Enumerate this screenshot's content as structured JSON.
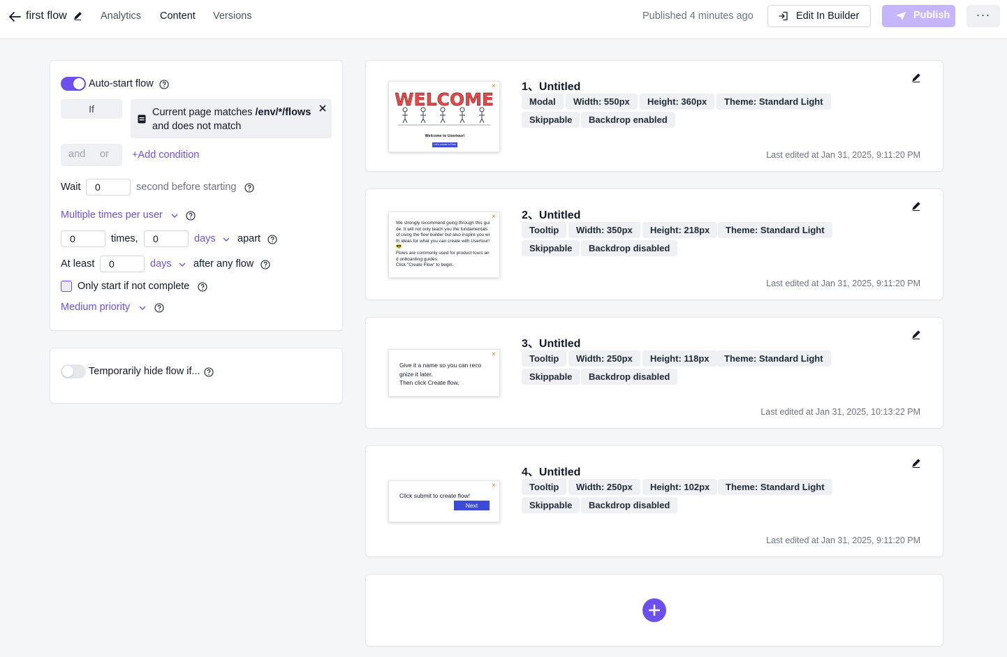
{
  "header": {
    "title": "first flow",
    "tabs": [
      {
        "label": "Analytics"
      },
      {
        "label": "Content"
      },
      {
        "label": "Versions"
      }
    ],
    "published_status": "Published 4 minutes ago",
    "edit_in_builder_label": "Edit In Builder",
    "publish_label": "Publish",
    "more_label": "···"
  },
  "colors": {
    "accent": "#6d4ff0",
    "publish_disabled": "#c4b5fd"
  },
  "autostart": {
    "toggle_on": true,
    "label": "Auto-start flow",
    "if_label": "If",
    "condition_prefix": "Current page matches ",
    "condition_path": "/env/*/flows",
    "condition_suffix": "and does not match",
    "and_label": "and",
    "or_label": "or",
    "add_condition_label": "Add condition",
    "wait_label": "Wait",
    "wait_value": "0",
    "wait_suffix": "second before starting",
    "frequency_label": "Multiple times per user",
    "times_value": "0",
    "times_label": "times,",
    "apart_value": "0",
    "apart_unit": "days",
    "apart_label": "apart",
    "atleast_label": "At least",
    "atleast_value": "0",
    "atleast_unit": "days",
    "atleast_suffix": "after any flow",
    "only_start_label": "Only start if not complete",
    "priority_label": "Medium priority"
  },
  "hide_flow": {
    "toggle_on": false,
    "label": "Temporarily hide flow if..."
  },
  "steps": [
    {
      "title": "1、Untitled",
      "tags": [
        "Modal",
        "Width: 550px",
        "Height: 360px",
        "Theme: Standard Light",
        "Skippable",
        "Backdrop enabled"
      ],
      "edited": "Last edited at Jan 31, 2025, 9:11:20 PM",
      "thumb": {
        "heading": "WELCOME",
        "text": "Welcome to Usertour!",
        "button": "Let's create a Flow"
      }
    },
    {
      "title": "2、Untitled",
      "tags": [
        "Tooltip",
        "Width: 350px",
        "Height: 218px",
        "Theme: Standard Light",
        "Skippable",
        "Backdrop disabled"
      ],
      "edited": "Last edited at Jan 31, 2025, 9:11:20 PM",
      "thumb": {
        "lines": [
          "We strongly recommend going through this gui",
          "de. It will not only teach you the fundamentals",
          "of using the flow builder but also inspire you wi",
          "th ideas for what you can create with Usertour!",
          "😎",
          "Flows are commonly used for product tours an",
          "d onboarding guides.",
          "Click \"Create Flow\" to begin."
        ]
      }
    },
    {
      "title": "3、Untitled",
      "tags": [
        "Tooltip",
        "Width: 250px",
        "Height: 118px",
        "Theme: Standard Light",
        "Skippable",
        "Backdrop disabled"
      ],
      "edited": "Last edited at Jan 31, 2025, 10:13:22 PM",
      "thumb": {
        "lines": [
          "Give it a name so you can reco",
          "gnize it later.",
          "Then click Create flow."
        ]
      }
    },
    {
      "title": "4、Untitled",
      "tags": [
        "Tooltip",
        "Width: 250px",
        "Height: 102px",
        "Theme: Standard Light",
        "Skippable",
        "Backdrop disabled"
      ],
      "edited": "Last edited at Jan 31, 2025, 9:11:20 PM",
      "thumb": {
        "text": "Click submit to create flow!",
        "button": "Next"
      }
    }
  ]
}
